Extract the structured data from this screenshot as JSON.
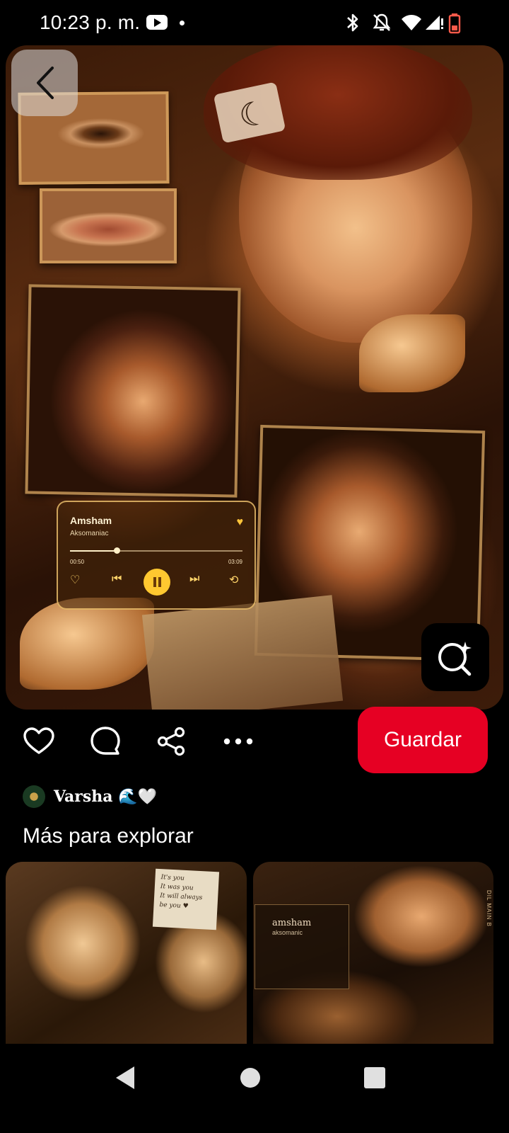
{
  "status_bar": {
    "time": "10:23 p. m.",
    "icons": [
      "youtube-icon",
      "dot-icon",
      "bluetooth-icon",
      "mute-icon",
      "wifi-icon",
      "signal-icon",
      "battery-low-icon"
    ]
  },
  "pin": {
    "music_card": {
      "title": "Amsham",
      "artist": "Aksomaniac",
      "time_elapsed": "00:50",
      "time_total": "03:09",
      "progress": 0.27
    }
  },
  "actions": {
    "icons": [
      "heart-icon",
      "comment-icon",
      "share-icon",
      "more-icon"
    ],
    "save_label": "Guardar",
    "save_color": "#e60023"
  },
  "author": {
    "name": "Varsha 🌊🤍"
  },
  "explore": {
    "title": "Más para explorar",
    "tile1_note": "It's you\nIt was you\nIt will always\nbe you ♥",
    "tile2_music_title": "amsham",
    "tile2_music_artist": "aksomanic",
    "tile2_side_text": "DIL MAIN B"
  },
  "nav_bar": {
    "icons": [
      "nav-back-icon",
      "nav-home-icon",
      "nav-recents-icon"
    ]
  }
}
